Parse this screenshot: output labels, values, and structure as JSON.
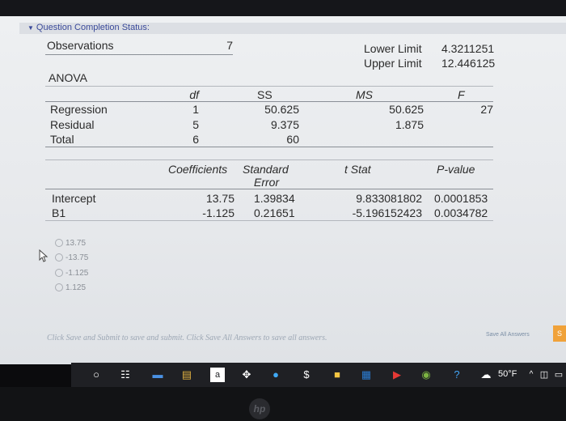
{
  "status": {
    "label": "Question Completion Status:"
  },
  "observations": {
    "label": "Observations",
    "value": "7"
  },
  "limits": {
    "lower_label": "Lower Limit",
    "lower_value": "4.3211251",
    "upper_label": "Upper Limit",
    "upper_value": "12.446125"
  },
  "anova": {
    "title": "ANOVA",
    "headers": {
      "df": "df",
      "ss": "SS",
      "ms": "MS",
      "f": "F"
    },
    "rows": [
      {
        "name": "Regression",
        "df": "1",
        "ss": "50.625",
        "ms": "50.625",
        "f": "27"
      },
      {
        "name": "Residual",
        "df": "5",
        "ss": "9.375",
        "ms": "1.875",
        "f": ""
      },
      {
        "name": "Total",
        "df": "6",
        "ss": "60",
        "ms": "",
        "f": ""
      }
    ]
  },
  "coefficients": {
    "headers": {
      "coef": "Coefficients",
      "se_line1": "Standard",
      "se_line2": "Error",
      "tstat": "t Stat",
      "pvalue": "P-value"
    },
    "rows": [
      {
        "name": "Intercept",
        "coef": "13.75",
        "se": "1.39834",
        "tstat": "9.833081802",
        "pvalue": "0.0001853"
      },
      {
        "name": "B1",
        "coef": "-1.125",
        "se": "0.21651",
        "tstat": "-5.196152423",
        "pvalue": "0.0034782"
      }
    ]
  },
  "options": [
    "13.75",
    "-13.75",
    "-1.125",
    "1.125"
  ],
  "footer": {
    "instruction": "Click Save and Submit to save and submit. Click Save All Answers to save all answers.",
    "save_all_label": "Save All Answers",
    "submit_label": "S"
  },
  "taskbar": {
    "temperature": "50°F"
  }
}
